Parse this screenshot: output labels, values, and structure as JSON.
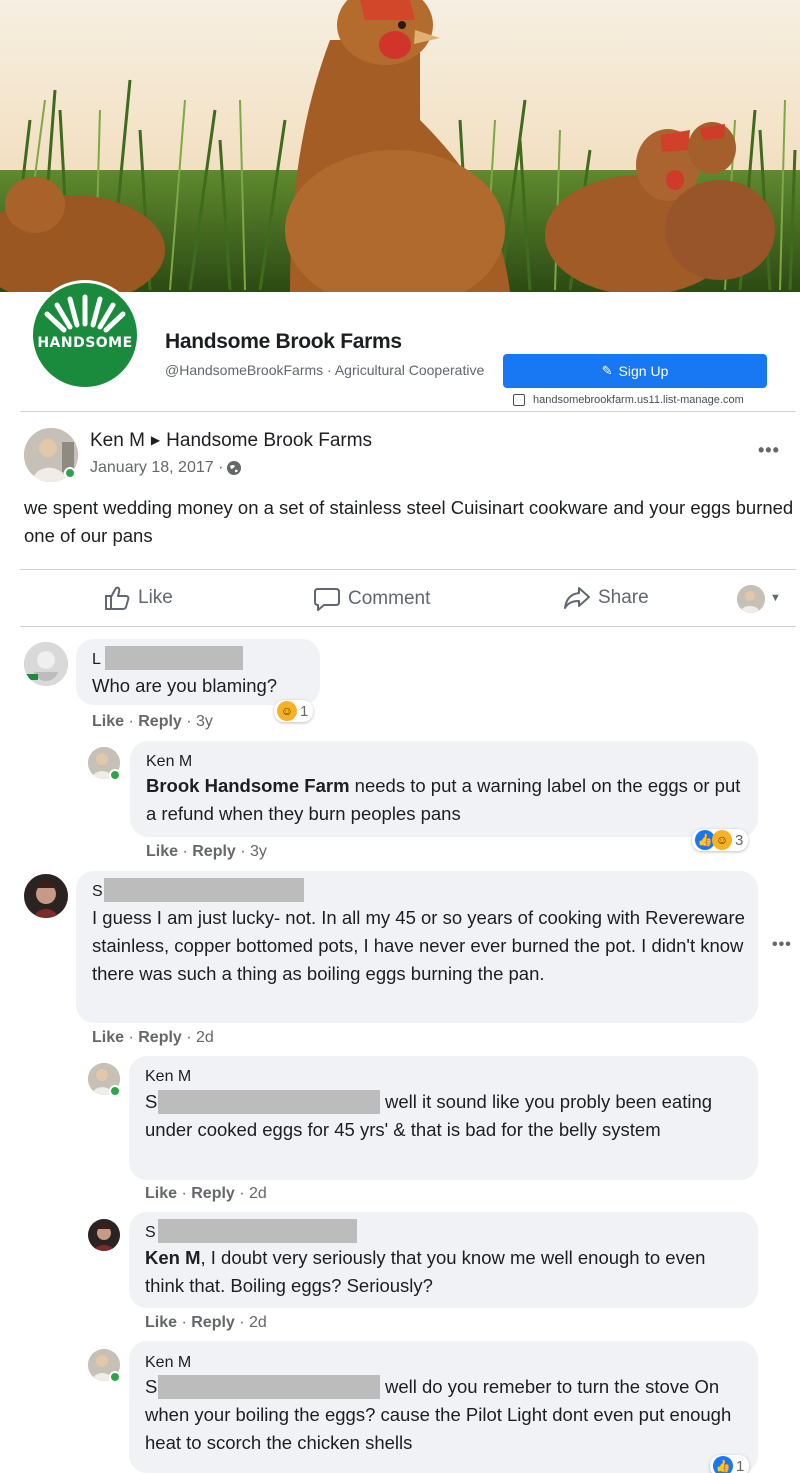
{
  "page": {
    "logo_text": "HANDSOME",
    "name": "Handsome Brook Farms",
    "handle_category": "@HandsomeBrookFarms · Agricultural Cooperative",
    "signup_label": "Sign Up",
    "website": "handsomebrookfarm.us11.list-manage.com"
  },
  "post": {
    "author": "Ken M",
    "target": "Handsome Brook Farms",
    "date": "January 18, 2017 ·",
    "text": "we spent wedding money on a set of stainless steel Cuisinart cookware and your eggs burned one of our pans",
    "actions": {
      "like": "Like",
      "comment": "Comment",
      "share": "Share"
    }
  },
  "comments": [
    {
      "name": "L",
      "text": "Who are you blaming?",
      "meta": {
        "like": "Like",
        "reply": "Reply",
        "age": "3y"
      },
      "reactions": {
        "icons": [
          "haha-icon"
        ],
        "count": "1"
      }
    },
    {
      "name": "Ken M",
      "mention": "Brook Handsome Farm",
      "text": " needs to put a warning label on the eggs or put a refund when they burn peoples pans",
      "meta": {
        "like": "Like",
        "reply": "Reply",
        "age": "3y"
      },
      "reactions": {
        "icons": [
          "like-icon",
          "haha-icon"
        ],
        "count": "3"
      }
    },
    {
      "name": "S",
      "text": "I guess I am just lucky- not. In all my 45 or so years of cooking with Revereware stainless, copper bottomed pots, I have never ever burned the pot. I didn't know there was such a thing as boiling eggs burning the pan.",
      "meta": {
        "like": "Like",
        "reply": "Reply",
        "age": "2d"
      }
    },
    {
      "name": "Ken M",
      "mention": "S",
      "text": "well it sound like you probly been eating under cooked eggs for 45 yrs' & that is bad for the belly system",
      "meta": {
        "like": "Like",
        "reply": "Reply",
        "age": "2d"
      }
    },
    {
      "name": "S",
      "mention": "Ken M",
      "text": ", I doubt very seriously that you know me well enough to even think that. Boiling eggs? Seriously?",
      "meta": {
        "like": "Like",
        "reply": "Reply",
        "age": "2d"
      }
    },
    {
      "name": "Ken M",
      "mention": "S",
      "text": "well do you remeber to turn the stove On when your boiling the eggs? cause the Pilot Light dont even put enough heat to scorch the chicken shells",
      "reactions": {
        "icons": [
          "like-icon"
        ],
        "count": "1"
      }
    }
  ],
  "colors": {
    "brand_green": "#1a8a3c",
    "facebook_blue": "#1877f2",
    "bubble_grey": "#f0f2f5",
    "online_green": "#31a24c"
  }
}
